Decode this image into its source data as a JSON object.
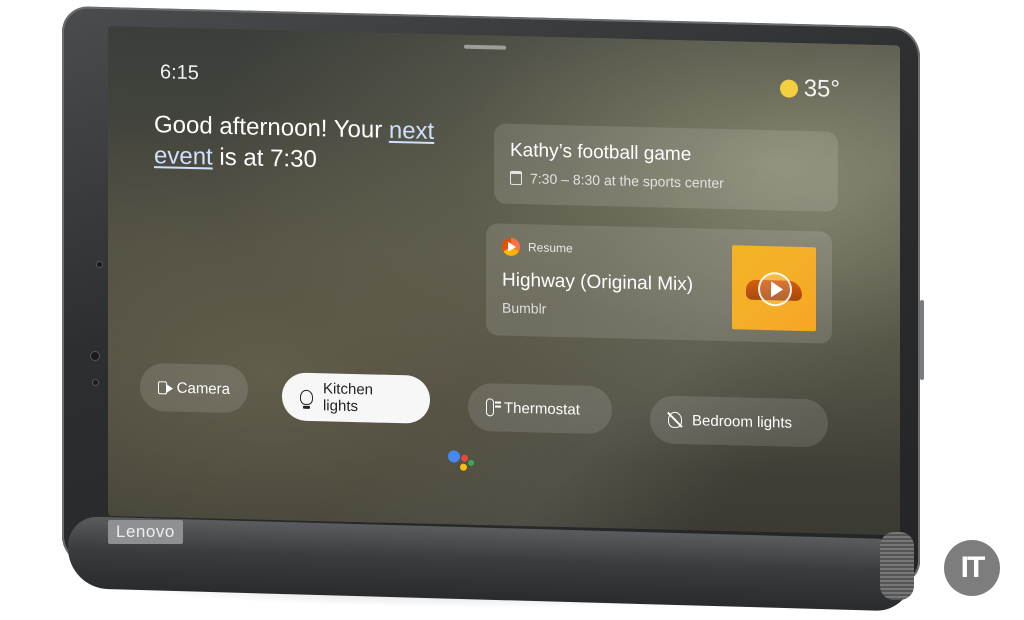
{
  "status": {
    "time": "6:15",
    "temperature": "35°"
  },
  "greeting": {
    "prefix": "Good afternoon! Your",
    "link": "next event",
    "suffix": "is at 7:30"
  },
  "event_card": {
    "title": "Kathy’s football game",
    "details": "7:30 – 8:30 at the sports center"
  },
  "media_card": {
    "source": "Resume",
    "title": "Highway (Original Mix)",
    "artist": "Bumblr"
  },
  "chips": [
    {
      "label": "Camera",
      "icon": "camera-icon"
    },
    {
      "label": "Kitchen lights",
      "icon": "lightbulb-icon",
      "active": true
    },
    {
      "label": "Thermostat",
      "icon": "thermostat-icon"
    },
    {
      "label": "Bedroom lights",
      "icon": "lightbulb-off-icon"
    }
  ],
  "device": {
    "brand": "Lenovo"
  },
  "watermark": "IT",
  "colors": {
    "assistant_blue": "#4285F4",
    "assistant_red": "#EA4335",
    "assistant_yellow": "#FBBC05",
    "assistant_green": "#34A853",
    "sun": "#F4D03F"
  }
}
